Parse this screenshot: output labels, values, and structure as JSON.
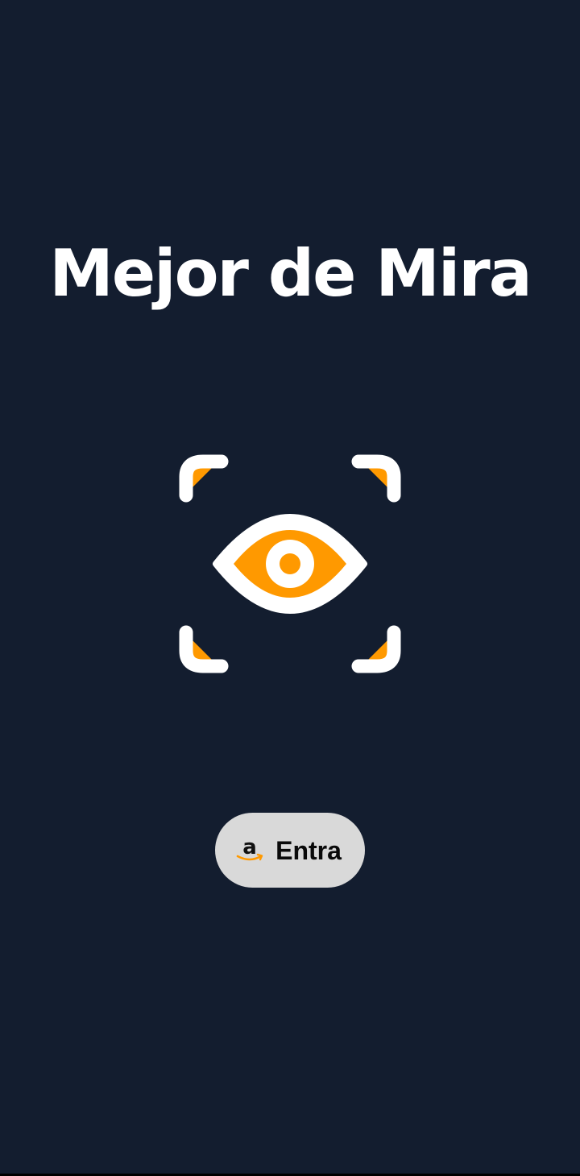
{
  "header": {
    "title": "Mejor de Mira"
  },
  "hero": {
    "icon": "eye-scan-icon"
  },
  "login": {
    "button_label": "Entra",
    "icon": "amazon-logo-icon"
  },
  "colors": {
    "background": "#131d2f",
    "accent": "#ff9900",
    "icon_white": "#ffffff",
    "button_bg": "#d9d9d9"
  }
}
